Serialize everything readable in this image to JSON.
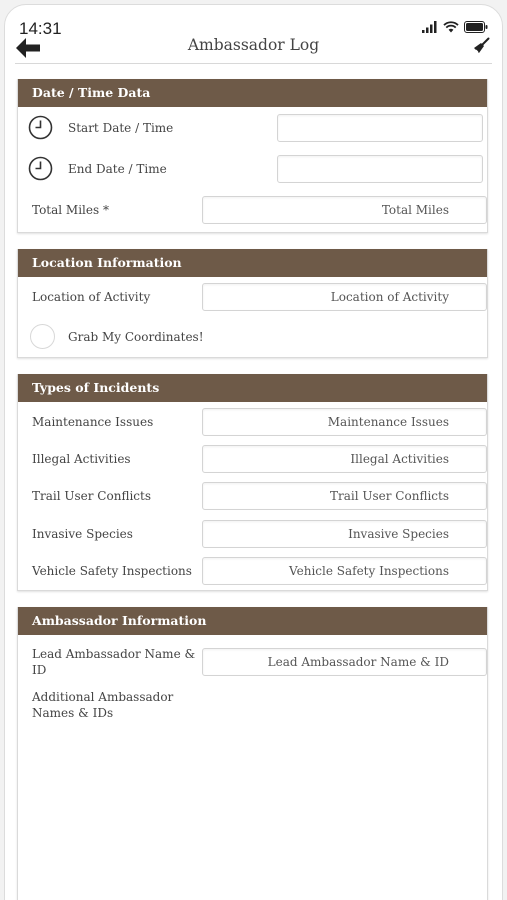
{
  "status_bar": {
    "time": "14:31"
  },
  "nav": {
    "title": "Ambassador Log"
  },
  "sections": {
    "datetime": {
      "header": "Date / Time Data",
      "start_label": "Start Date / Time",
      "end_label": "End Date / Time",
      "miles_label": "Total Miles *",
      "miles_placeholder": "Total Miles"
    },
    "location": {
      "header": "Location Information",
      "activity_label": "Location of Activity",
      "activity_placeholder": "Location of Activity",
      "coordinates_label": "Grab My Coordinates!"
    },
    "incidents": {
      "header": "Types of Incidents",
      "rows": [
        {
          "label": "Maintenance Issues",
          "placeholder": "Maintenance Issues"
        },
        {
          "label": "Illegal Activities",
          "placeholder": "Illegal Activities"
        },
        {
          "label": "Trail User Conflicts",
          "placeholder": "Trail User Conflicts"
        },
        {
          "label": "Invasive Species",
          "placeholder": "Invasive Species"
        },
        {
          "label": "Vehicle Safety Inspections",
          "placeholder": "Vehicle Safety Inspections"
        }
      ]
    },
    "ambassador": {
      "header": "Ambassador Information",
      "lead_label_line1": "Lead Ambassador Name &",
      "lead_label_line2": "ID",
      "lead_placeholder": "Lead Ambassador Name & ID",
      "additional_label_line1": "Additional Ambassador",
      "additional_label_line2": "Names & IDs"
    }
  },
  "colors": {
    "header_bg": "#6e5a48",
    "header_text": "#ffffff"
  }
}
